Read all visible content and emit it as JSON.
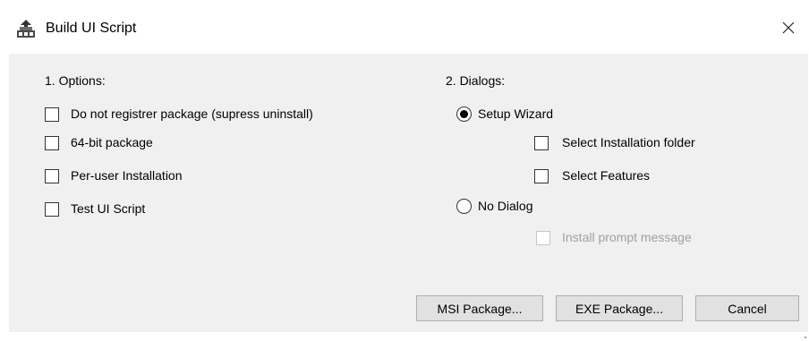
{
  "window": {
    "title": "Build UI Script",
    "icon": "build-script-icon",
    "close_icon": "close-icon"
  },
  "options": {
    "heading": "1. Options:",
    "items": [
      {
        "label": "Do not registrer package (supress uninstall)",
        "checked": false
      },
      {
        "label": "64-bit package",
        "checked": false
      },
      {
        "label": "Per-user Installation",
        "checked": false
      },
      {
        "label": "Test UI Script",
        "checked": false
      }
    ]
  },
  "dialogs": {
    "heading": "2. Dialogs:",
    "setup_wizard": {
      "label": "Setup Wizard",
      "selected": true
    },
    "select_installation_folder": {
      "label": "Select Installation folder",
      "checked": false
    },
    "select_features": {
      "label": "Select Features",
      "checked": false
    },
    "no_dialog": {
      "label": "No Dialog",
      "selected": false
    },
    "install_prompt": {
      "label": "Install prompt message",
      "checked": false,
      "enabled": false
    }
  },
  "buttons": {
    "msi": "MSI Package...",
    "exe": "EXE Package...",
    "cancel": "Cancel"
  }
}
